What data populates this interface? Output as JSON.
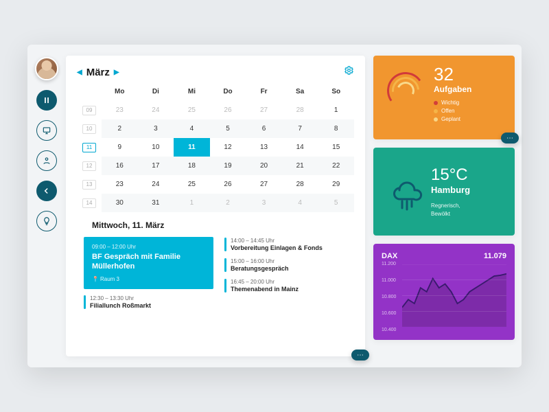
{
  "month": {
    "label": "März"
  },
  "weekdays": [
    "Mo",
    "Di",
    "Mi",
    "Do",
    "Fr",
    "Sa",
    "So"
  ],
  "weeks": [
    {
      "num": "09",
      "active": false,
      "alt": false,
      "days": [
        "23",
        "24",
        "25",
        "26",
        "27",
        "28",
        "1"
      ],
      "dimStart": 0,
      "dimEnd": 5
    },
    {
      "num": "10",
      "active": false,
      "alt": true,
      "days": [
        "2",
        "3",
        "4",
        "5",
        "6",
        "7",
        "8"
      ]
    },
    {
      "num": "11",
      "active": true,
      "alt": false,
      "days": [
        "9",
        "10",
        "11",
        "12",
        "13",
        "14",
        "15"
      ],
      "today": 2
    },
    {
      "num": "12",
      "active": false,
      "alt": true,
      "days": [
        "16",
        "17",
        "18",
        "19",
        "20",
        "21",
        "22"
      ]
    },
    {
      "num": "13",
      "active": false,
      "alt": false,
      "days": [
        "23",
        "24",
        "25",
        "26",
        "27",
        "28",
        "29"
      ]
    },
    {
      "num": "14",
      "active": false,
      "alt": true,
      "days": [
        "30",
        "31",
        "1",
        "2",
        "3",
        "4",
        "5"
      ],
      "dimStart": 2,
      "dimEnd": 6
    }
  ],
  "dayTitle": "Mittwoch, 11. März",
  "featured": {
    "time": "09:00 – 12:00 Uhr",
    "title": "BF Gespräch mit Familie Müllerhofen",
    "location": "Raum 3"
  },
  "leftEvents": [
    {
      "time": "12:30 – 13:30 Uhr",
      "title": "Filiallunch Roßmarkt"
    }
  ],
  "rightEvents": [
    {
      "time": "14:00 – 14:45 Uhr",
      "title": "Vorbereitung Einlagen & Fonds"
    },
    {
      "time": "15:00 – 16:00 Uhr",
      "title": "Beratungsgespräch"
    },
    {
      "time": "16:45 – 20:00 Uhr",
      "title": "Themenabend in Mainz"
    }
  ],
  "tasks": {
    "count": "32",
    "label": "Aufgaben",
    "legend": [
      "Wichtig",
      "Offen",
      "Geplant"
    ]
  },
  "weather": {
    "temp": "15°C",
    "city": "Hamburg",
    "desc1": "Regnerisch,",
    "desc2": "Bewölkt"
  },
  "stocks": {
    "symbol": "DAX",
    "value": "11.079",
    "yticks": [
      "11.200",
      "11.000",
      "10.800",
      "10.600",
      "10.400"
    ]
  },
  "chart_data": {
    "type": "line",
    "title": "DAX",
    "ylabel": "",
    "xlabel": "",
    "ylim": [
      10400,
      11200
    ],
    "x": [
      0,
      1,
      2,
      3,
      4,
      5,
      6,
      7,
      8,
      9,
      10,
      11,
      12,
      13,
      14,
      15,
      16,
      17
    ],
    "series": [
      {
        "name": "DAX",
        "values": [
          10650,
          10750,
          10700,
          10900,
          10850,
          11020,
          10900,
          10950,
          10850,
          10700,
          10750,
          10850,
          10900,
          10950,
          11000,
          11050,
          11060,
          11079
        ]
      }
    ]
  }
}
